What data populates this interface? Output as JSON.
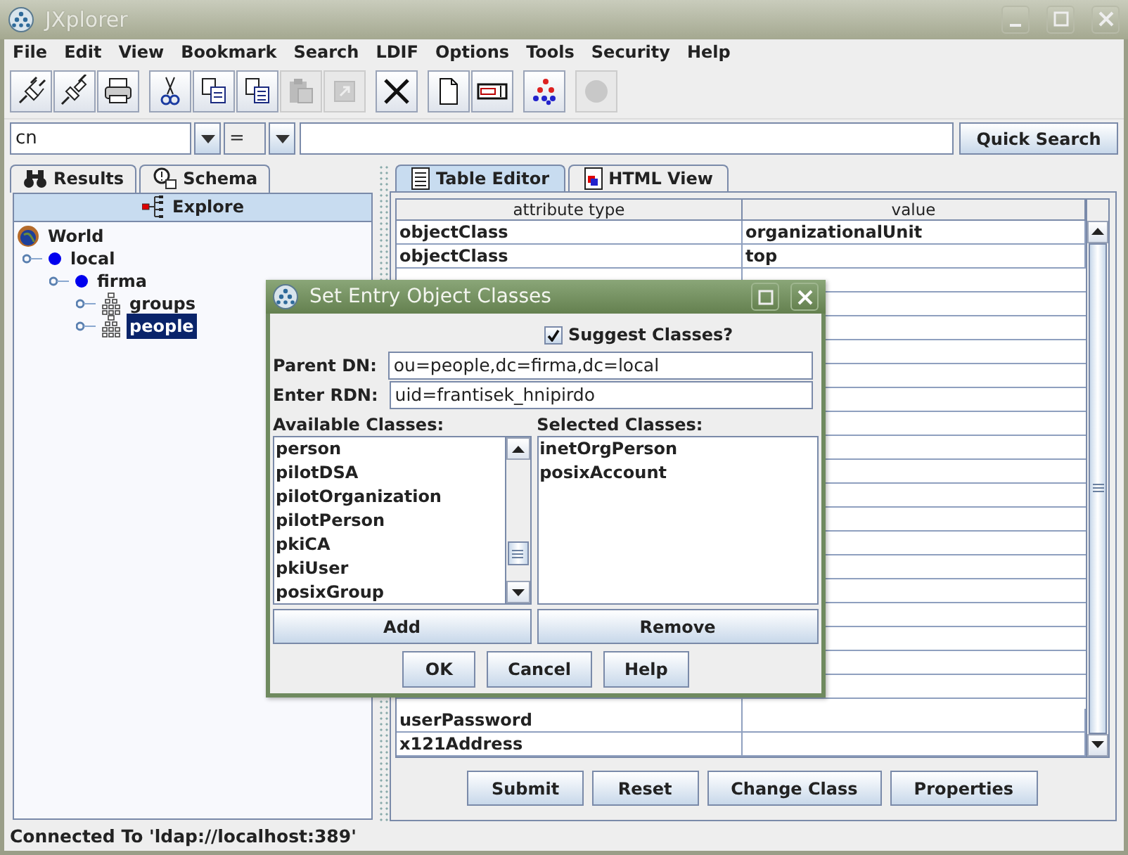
{
  "window": {
    "title": "JXplorer"
  },
  "menu": [
    {
      "label": "File"
    },
    {
      "label": "Edit"
    },
    {
      "label": "View"
    },
    {
      "label": "Bookmark"
    },
    {
      "label": "Search"
    },
    {
      "label": "LDIF"
    },
    {
      "label": "Options"
    },
    {
      "label": "Tools"
    },
    {
      "label": "Security"
    },
    {
      "label": "Help"
    }
  ],
  "toolbar": [
    [
      {
        "kind": "connect",
        "disabled": false
      },
      {
        "kind": "disconnect",
        "disabled": false
      },
      {
        "kind": "print",
        "disabled": false
      }
    ],
    [
      {
        "kind": "cut",
        "disabled": false
      },
      {
        "kind": "copy",
        "disabled": false
      },
      {
        "kind": "copydn",
        "disabled": false
      },
      {
        "kind": "paste",
        "disabled": true
      },
      {
        "kind": "pastealias",
        "disabled": true
      }
    ],
    [
      {
        "kind": "delete",
        "disabled": false
      }
    ],
    [
      {
        "kind": "new",
        "disabled": false
      },
      {
        "kind": "rename",
        "disabled": false
      }
    ],
    [
      {
        "kind": "refresh",
        "disabled": false
      }
    ],
    [
      {
        "kind": "stop",
        "disabled": true
      }
    ]
  ],
  "search": {
    "attribute": "cn",
    "operator": "=",
    "button": "Quick Search"
  },
  "left_tabs": [
    {
      "label": "Results",
      "kind": "results",
      "selected": false
    },
    {
      "label": "Schema",
      "kind": "schema",
      "selected": false
    },
    {
      "label": "Explore",
      "kind": "explore",
      "selected": true
    }
  ],
  "tree": [
    {
      "label": "World",
      "kind": "world",
      "selected": false,
      "children": [
        {
          "label": "local",
          "kind": "domain",
          "selected": false,
          "children": [
            {
              "label": "firma",
              "kind": "domain",
              "selected": false,
              "children": [
                {
                  "label": "groups",
                  "kind": "unit",
                  "selected": false
                },
                {
                  "label": "people",
                  "kind": "unit",
                  "selected": true
                }
              ]
            }
          ]
        }
      ]
    }
  ],
  "right_tabs": [
    {
      "label": "Table Editor",
      "kind": "table",
      "selected": true
    },
    {
      "label": "HTML View",
      "kind": "html",
      "selected": false
    }
  ],
  "table": {
    "columns": [
      "attribute type",
      "value"
    ],
    "rows": [
      {
        "attribute": "objectClass",
        "value": "organizationalUnit",
        "link": false
      },
      {
        "attribute": "objectClass",
        "value": "top",
        "link": false
      }
    ],
    "more_rows": [
      {
        "attribute": "userPassword"
      },
      {
        "attribute": "x121Address"
      }
    ]
  },
  "editor_buttons": [
    "Submit",
    "Reset",
    "Change Class",
    "Properties"
  ],
  "status_bar": "Connected To 'ldap://localhost:389'",
  "dialog": {
    "title": "Set Entry Object Classes",
    "suggest": {
      "label": "Suggest Classes?",
      "checked": true
    },
    "parent_dn": {
      "label": "Parent DN:",
      "value": "ou=people,dc=firma,dc=local"
    },
    "rdn": {
      "label": "Enter RDN:",
      "value": "uid=frantisek_hnipirdo"
    },
    "available": {
      "label": "Available Classes:",
      "items": [
        "person",
        "pilotDSA",
        "pilotOrganization",
        "pilotPerson",
        "pkiCA",
        "pkiUser",
        "posixGroup"
      ]
    },
    "selected": {
      "label": "Selected Classes:",
      "items": [
        "inetOrgPerson",
        "posixAccount"
      ]
    },
    "list_buttons": [
      "Add",
      "Remove"
    ],
    "buttons": [
      "OK",
      "Cancel",
      "Help"
    ]
  }
}
